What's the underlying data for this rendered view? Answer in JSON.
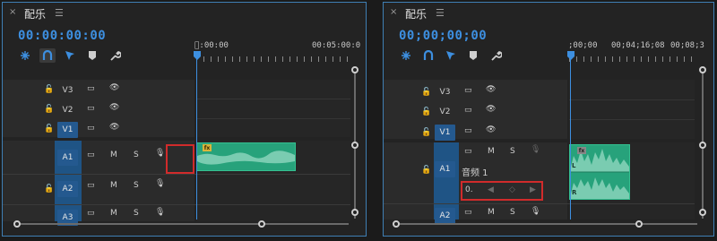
{
  "panel1": {
    "close": "×",
    "title": "配乐",
    "menu": "☰",
    "timecode": "00:00:00:00",
    "ruler": [
      "\u0000:00:00",
      "00:05:00:0"
    ],
    "tracks_video": [
      "V3",
      "V2",
      "V1"
    ],
    "tracks_audio": [
      "A1",
      "A2",
      "A3"
    ],
    "m_label": "M",
    "s_label": "S"
  },
  "panel2": {
    "close": "×",
    "title": "配乐",
    "menu": "☰",
    "timecode": "00;00;00;00",
    "ruler": [
      ";00;00",
      "00;04;16;08",
      "00;08;3"
    ],
    "tracks_video": [
      "V3",
      "V2",
      "V1"
    ],
    "tracks_audio": [
      "A1",
      "A2"
    ],
    "m_label": "M",
    "s_label": "S",
    "audio_name": "音频 1",
    "volume": "0.",
    "clip_l": "L",
    "clip_r": "R"
  },
  "colors": {
    "accent": "#3d8fe0",
    "clip": "#27a27b",
    "highlight": "#d12b2b",
    "selected_track": "#24598f"
  }
}
